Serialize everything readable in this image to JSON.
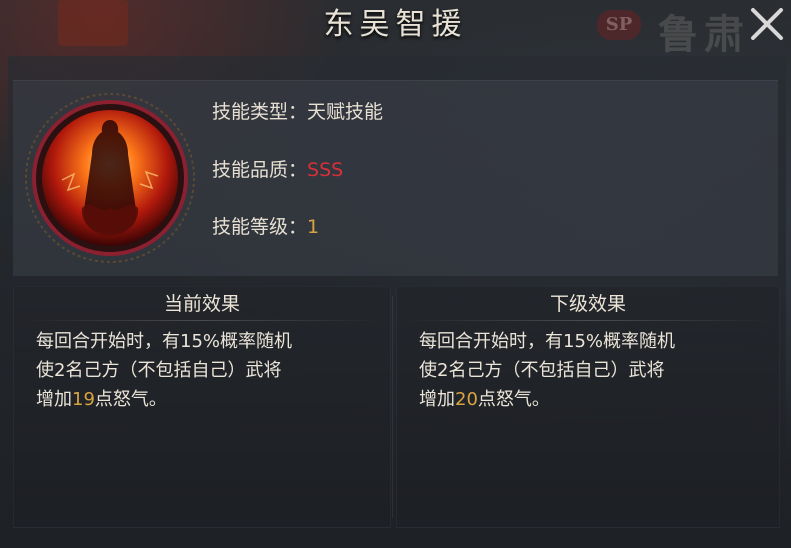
{
  "window": {
    "title": "东吴智援",
    "close_icon": "close-icon"
  },
  "skill": {
    "icon": "burning-warrior-skill-icon",
    "type_label": "技能类型：",
    "type_value": "天赋技能",
    "quality_label": "技能品质：",
    "quality_value": "SSS",
    "level_label": "技能等级：",
    "level_value": "1"
  },
  "current_effect": {
    "header": "当前效果",
    "line1": "每回合开始时，有15%概率随机",
    "line2": "使2名己方（不包括自己）武将",
    "line3_prefix": "增加",
    "line3_value": "19",
    "line3_suffix": "点怒气。"
  },
  "next_effect": {
    "header": "下级效果",
    "line1": "每回合开始时，有15%概率随机",
    "line2": "使2名己方（不包括自己）武将",
    "line3_prefix": "增加",
    "line3_value": "20",
    "line3_suffix": "点怒气。"
  },
  "colors": {
    "quality_red": "#d8303a",
    "highlight_gold": "#d9a441",
    "text": "#e6dfd2"
  }
}
